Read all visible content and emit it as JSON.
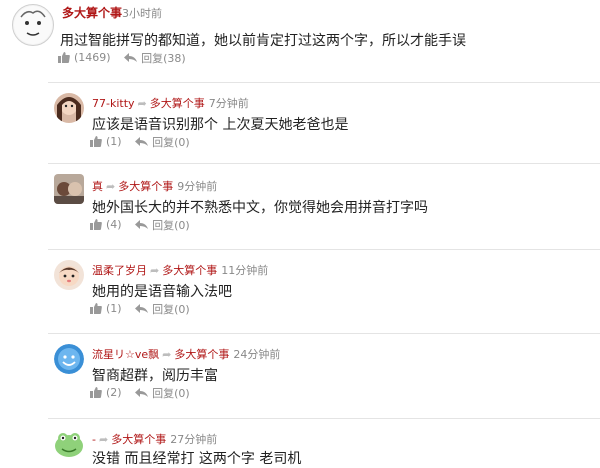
{
  "top_comment": {
    "username": "多大算个事",
    "time": "3小时前",
    "content": "用过智能拼写的都知道，她以前肯定打过这两个字，所以才能手误",
    "likes": "(1469)",
    "reply_label": "回复",
    "reply_count": "(38)"
  },
  "replies": [
    {
      "username": "77-kitty",
      "reply_to": "多大算个事",
      "time": "7分钟前",
      "content": "应该是语音识别那个 上次夏天她老爸也是",
      "likes": "(1)",
      "reply_label": "回复",
      "reply_count": "(0)"
    },
    {
      "username": "真",
      "reply_to": "多大算个事",
      "time": "9分钟前",
      "content": "她外国长大的并不熟悉中文，你觉得她会用拼音打字吗",
      "likes": "(4)",
      "reply_label": "回复",
      "reply_count": "(0)"
    },
    {
      "username": "温柔了岁月",
      "reply_to": "多大算个事",
      "time": "11分钟前",
      "content": "她用的是语音输入法吧",
      "likes": "(1)",
      "reply_label": "回复",
      "reply_count": "(0)"
    },
    {
      "username": "流星リ☆ve飘",
      "reply_to": "多大算个事",
      "time": "24分钟前",
      "content": "智商超群，阅历丰富",
      "likes": "(2)",
      "reply_label": "回复",
      "reply_count": "(0)"
    },
    {
      "username": "-",
      "reply_to": "多大算个事",
      "time": "27分钟前",
      "content": "没错 而且经常打 这两个字 老司机",
      "likes": "",
      "reply_label": "",
      "reply_count": ""
    }
  ],
  "colors": {
    "username": "#b01717",
    "meta": "#888888",
    "text": "#222222",
    "divider": "#e4e4e4"
  }
}
